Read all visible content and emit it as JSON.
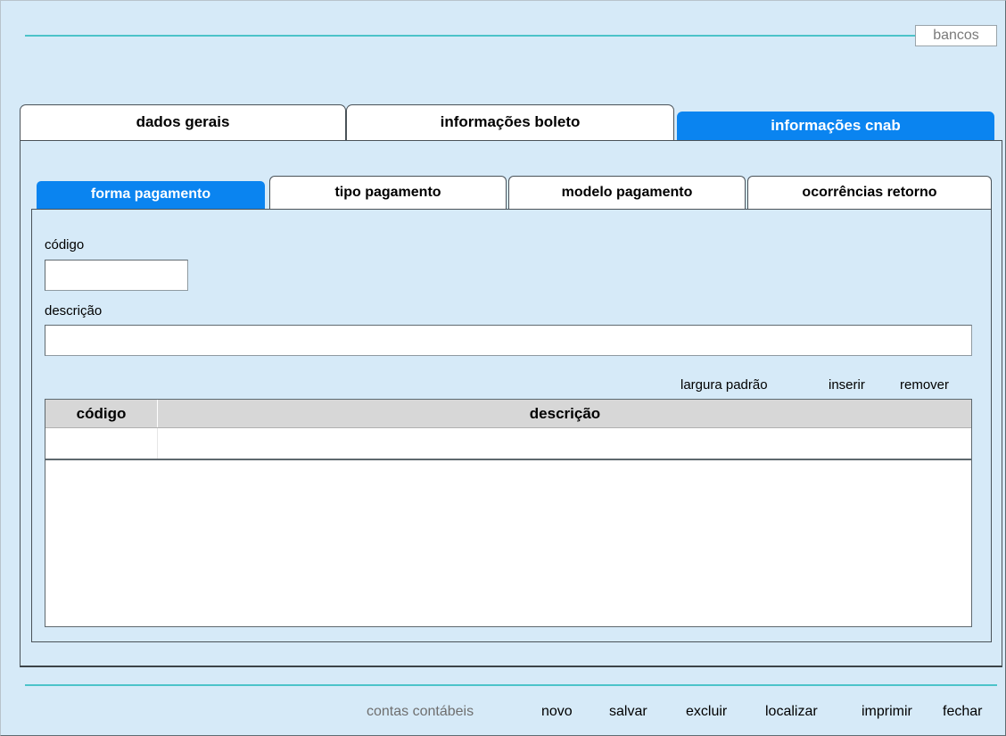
{
  "header": {
    "badge": "bancos",
    "accent_color": "#4cc3c9"
  },
  "main_tabs": [
    {
      "label": "dados gerais",
      "active": false
    },
    {
      "label": "informações boleto",
      "active": false
    },
    {
      "label": "informações cnab",
      "active": true
    }
  ],
  "sub_tabs": [
    {
      "label": "forma pagamento",
      "active": true
    },
    {
      "label": "tipo pagamento",
      "active": false
    },
    {
      "label": "modelo pagamento",
      "active": false
    },
    {
      "label": "ocorrências retorno",
      "active": false
    }
  ],
  "form": {
    "codigo_label": "código",
    "codigo_value": "",
    "descricao_label": "descrição",
    "descricao_value": ""
  },
  "grid_actions": {
    "width": "largura padrão",
    "insert": "inserir",
    "remove": "remover"
  },
  "grid": {
    "columns": [
      "código",
      "descrição"
    ],
    "rows": [
      [
        "",
        ""
      ]
    ]
  },
  "footer": {
    "items": [
      "contas contábeis",
      "novo",
      "salvar",
      "excluir",
      "localizar",
      "imprimir",
      "fechar"
    ]
  },
  "colors": {
    "active_tab": "#0a84f0",
    "background": "#d6eaf8"
  }
}
